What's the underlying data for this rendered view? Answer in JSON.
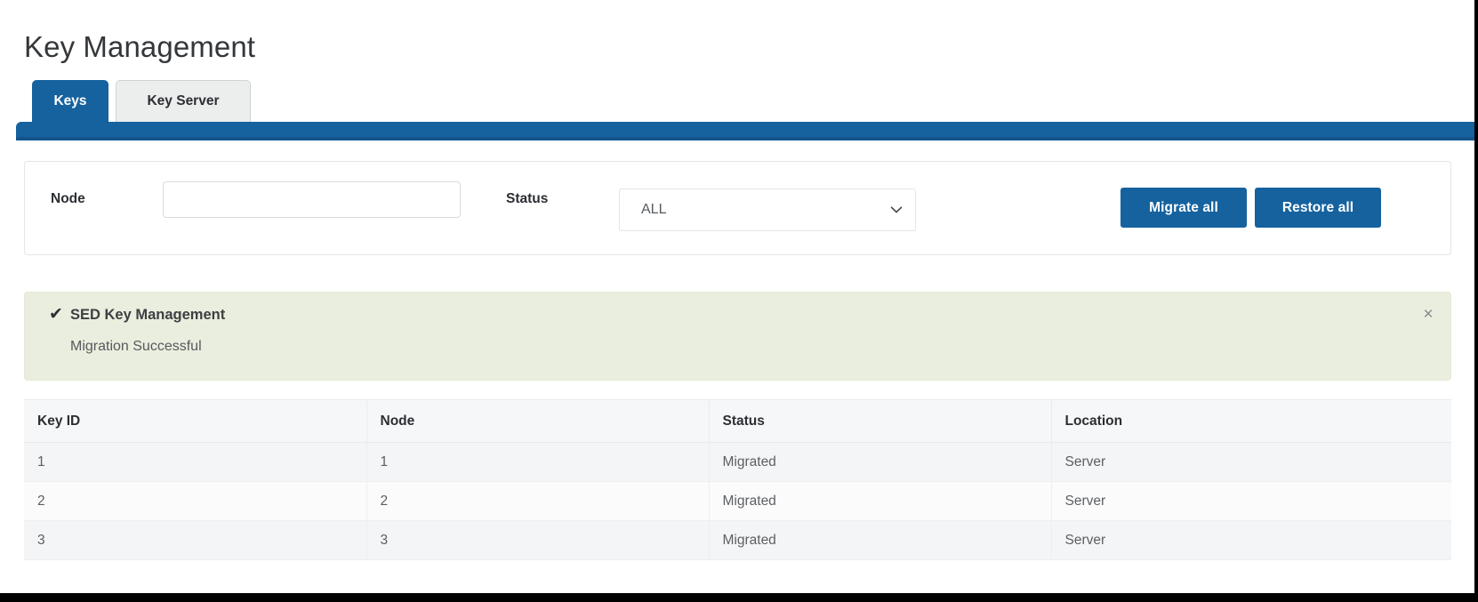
{
  "page": {
    "title": "Key Management"
  },
  "tabs": [
    {
      "label": "Keys",
      "active": true
    },
    {
      "label": "Key Server",
      "active": false
    }
  ],
  "filters": {
    "node": {
      "label": "Node",
      "value": "",
      "placeholder": ""
    },
    "status": {
      "label": "Status",
      "selected": "ALL",
      "options": [
        "ALL"
      ],
      "chevron_icon": "chevron-down-icon"
    },
    "actions": {
      "migrate_all": "Migrate all",
      "restore_all": "Restore all"
    }
  },
  "alert": {
    "icon": "check-icon",
    "icon_glyph": "✔",
    "title": "SED Key Management",
    "message": "Migration Successful",
    "close_glyph": "×",
    "close_icon": "close-icon",
    "background_color": "#eaeede"
  },
  "table": {
    "columns": [
      "Key ID",
      "Node",
      "Status",
      "Location"
    ],
    "rows": [
      [
        "1",
        "1",
        "Migrated",
        "Server"
      ],
      [
        "2",
        "2",
        "Migrated",
        "Server"
      ],
      [
        "3",
        "3",
        "Migrated",
        "Server"
      ]
    ]
  },
  "colors": {
    "accent": "#15629f",
    "tab_inactive": "#eceded",
    "alert_green": "#eaeede",
    "text": "#2b2f33"
  }
}
